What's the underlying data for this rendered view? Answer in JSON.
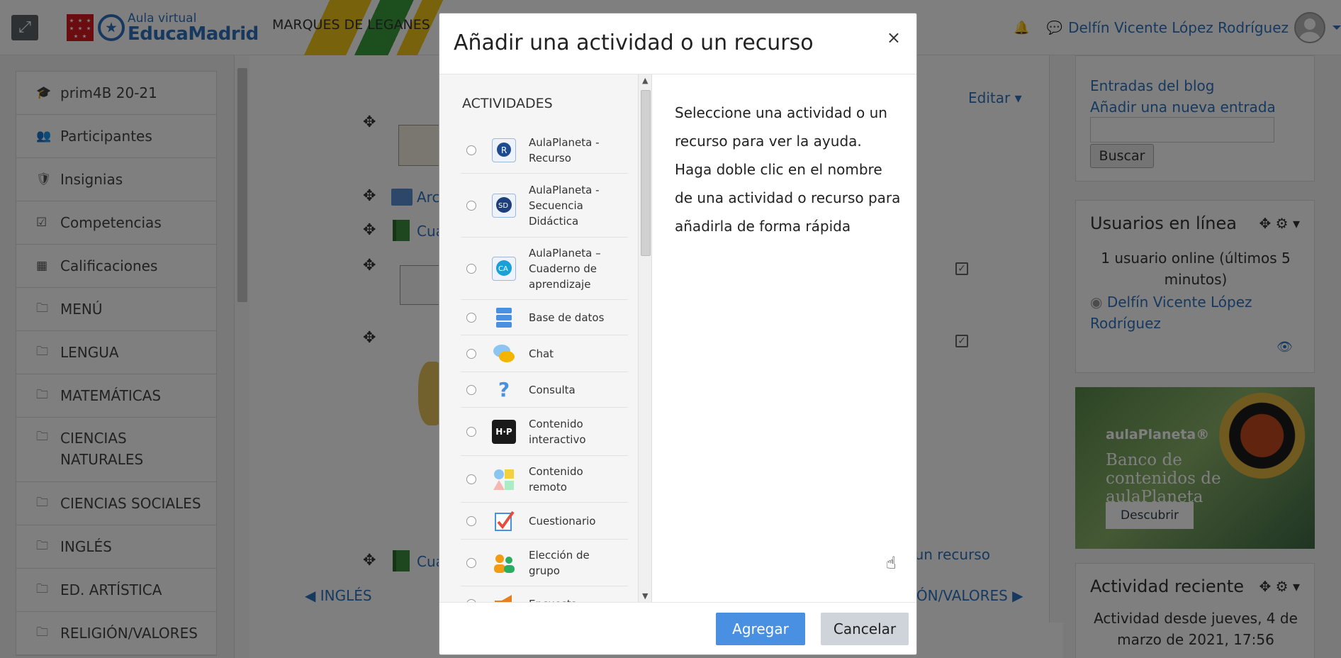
{
  "navbar": {
    "logo_small": "Aula virtual",
    "logo_main": "EducaMadrid",
    "school": "MARQUES DE LEGANES",
    "user_name": "Delfín Vicente López Rodríguez"
  },
  "drawer": {
    "items": [
      {
        "icon": "graduation-cap-icon",
        "glyph": "🎓",
        "label": "prim4B 20-21"
      },
      {
        "icon": "users-icon",
        "glyph": "👥",
        "label": "Participantes"
      },
      {
        "icon": "badge-icon",
        "glyph": "🛡",
        "label": "Insignias"
      },
      {
        "icon": "checkbox-icon",
        "glyph": "☑",
        "label": "Competencias"
      },
      {
        "icon": "table-icon",
        "glyph": "▦",
        "label": "Calificaciones"
      },
      {
        "icon": "folder-icon",
        "glyph": "🗀",
        "label": "MENÚ"
      },
      {
        "icon": "folder-icon",
        "glyph": "🗀",
        "label": "LENGUA"
      },
      {
        "icon": "folder-icon",
        "glyph": "🗀",
        "label": "MATEMÁTICAS"
      },
      {
        "icon": "folder-icon",
        "glyph": "🗀",
        "label": "CIENCIAS NATURALES"
      },
      {
        "icon": "folder-icon",
        "glyph": "🗀",
        "label": "CIENCIAS SOCIALES"
      },
      {
        "icon": "folder-icon",
        "glyph": "🗀",
        "label": "INGLÉS"
      },
      {
        "icon": "folder-icon",
        "glyph": "🗀",
        "label": "ED. ARTÍSTICA"
      },
      {
        "icon": "folder-icon",
        "glyph": "🗀",
        "label": "RELIGIÓN/VALORES"
      }
    ]
  },
  "main": {
    "edit_label": "Editar",
    "activity_1": "Arc",
    "activity_2": "Cua",
    "activity_3": "Cua",
    "add_resource": "o un recurso",
    "prev_section": "◀ INGLÉS",
    "next_section": "IÓN/VALORES ▶"
  },
  "blog_block": {
    "entries_link": "Entradas del blog",
    "add_link": "Añadir una nueva entrada",
    "search_button": "Buscar"
  },
  "online_block": {
    "title": "Usuarios en línea",
    "summary": "1 usuario online (últimos 5 minutos)",
    "user": "Delfín Vicente López Rodríguez"
  },
  "promo": {
    "brand": "aulaPlaneta®",
    "title": "Banco de contenidos de aulaPlaneta",
    "button": "Descubrir"
  },
  "recent_block": {
    "title": "Actividad reciente",
    "text": "Actividad desde jueves, 4 de marzo de 2021, 17:56"
  },
  "modal": {
    "title": "Añadir una actividad o un recurso",
    "close": "×",
    "section_title": "ACTIVIDADES",
    "help_text": "Seleccione una actividad o un recurso para ver la ayuda. Haga doble clic en el nombre de una actividad o recurso para añadirla de forma rápida",
    "add_button": "Agregar",
    "cancel_button": "Cancelar",
    "options": [
      {
        "icon": "aulaplaneta-recurso-icon",
        "label": "AulaPlaneta - Recurso"
      },
      {
        "icon": "aulaplaneta-secuencia-icon",
        "label": "AulaPlaneta - Secuencia Didáctica"
      },
      {
        "icon": "aulaplaneta-cuaderno-icon",
        "label": "AulaPlaneta – Cuaderno de aprendizaje"
      },
      {
        "icon": "database-icon",
        "label": "Base de datos"
      },
      {
        "icon": "chat-icon",
        "label": "Chat"
      },
      {
        "icon": "question-icon",
        "label": "Consulta"
      },
      {
        "icon": "h5p-icon",
        "label": "Contenido interactivo"
      },
      {
        "icon": "shapes-icon",
        "label": "Contenido remoto"
      },
      {
        "icon": "quiz-icon",
        "label": "Cuestionario"
      },
      {
        "icon": "group-choice-icon",
        "label": "Elección de grupo"
      },
      {
        "icon": "megaphone-icon",
        "label": "Encuesta"
      }
    ]
  }
}
